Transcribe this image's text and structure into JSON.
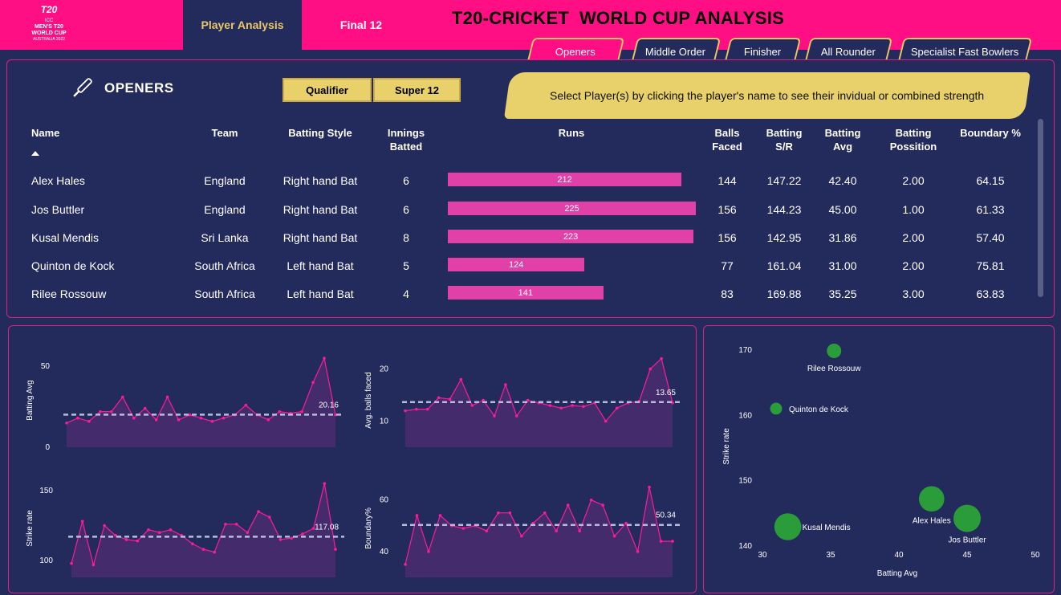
{
  "header": {
    "logo_lines": [
      "ICC",
      "MEN'S T20",
      "WORLD CUP",
      "AUSTRALIA 2022"
    ],
    "tabs": [
      {
        "label": "Player Analysis",
        "active": true
      },
      {
        "label": "Final 12",
        "active": false
      }
    ],
    "title": "T20-CRICKET  WORLD CUP ANALYSIS"
  },
  "categories": [
    {
      "label": "Openers",
      "active": true
    },
    {
      "label": "Middle Order",
      "active": false
    },
    {
      "label": "Finisher",
      "active": false
    },
    {
      "label": "All Rounder",
      "active": false
    },
    {
      "label": "Specialist Fast Bowlers",
      "active": false
    }
  ],
  "section": {
    "title": "OPENERS",
    "stage_buttons": [
      "Qualifier",
      "Super 12"
    ],
    "info": "Select Player(s) by clicking the player's name to see their invidual or combined strength"
  },
  "table": {
    "headers": {
      "name": "Name",
      "team": "Team",
      "style": "Batting Style",
      "innings": [
        "Innings",
        "Batted"
      ],
      "runs": "Runs",
      "balls": [
        "Balls",
        "Faced"
      ],
      "sr": [
        "Batting",
        "S/R"
      ],
      "avg": [
        "Batting",
        "Avg"
      ],
      "pos": [
        "Batting",
        "Possition"
      ],
      "boundary": "Boundary %"
    },
    "runs_max": 225,
    "rows": [
      {
        "name": "Alex Hales",
        "team": "England",
        "style": "Right hand Bat",
        "innings": "6",
        "runs": 212,
        "balls": "144",
        "sr": "147.22",
        "avg": "42.40",
        "pos": "2.00",
        "boundary": "64.15"
      },
      {
        "name": "Jos Buttler",
        "team": "England",
        "style": "Right hand Bat",
        "innings": "6",
        "runs": 225,
        "balls": "156",
        "sr": "144.23",
        "avg": "45.00",
        "pos": "1.00",
        "boundary": "61.33"
      },
      {
        "name": "Kusal Mendis",
        "team": "Sri Lanka",
        "style": "Right hand Bat",
        "innings": "8",
        "runs": 223,
        "balls": "156",
        "sr": "142.95",
        "avg": "31.86",
        "pos": "2.00",
        "boundary": "57.40"
      },
      {
        "name": "Quinton de Kock",
        "team": "South Africa",
        "style": "Left hand Bat",
        "innings": "5",
        "runs": 124,
        "balls": "77",
        "sr": "161.04",
        "avg": "31.00",
        "pos": "2.00",
        "boundary": "75.81"
      },
      {
        "name": "Rilee Rossouw",
        "team": "South Africa",
        "style": "Left hand Bat",
        "innings": "4",
        "runs": 141,
        "balls": "83",
        "sr": "169.88",
        "avg": "35.25",
        "pos": "3.00",
        "boundary": "63.83"
      }
    ]
  },
  "chart_data": [
    {
      "type": "area",
      "ylabel": "Batting Avg",
      "yticks": [
        0,
        50
      ],
      "ylim": [
        0,
        58
      ],
      "average": 20.16,
      "average_label": "20.16",
      "values": [
        15,
        18,
        16,
        22,
        22,
        31,
        18,
        24,
        17,
        31,
        17,
        20,
        18,
        16,
        18,
        20,
        26,
        20,
        17,
        22,
        21,
        22,
        40,
        55,
        20
      ]
    },
    {
      "type": "area",
      "ylabel": "Avg. balls faced",
      "yticks": [
        10,
        20
      ],
      "ylim": [
        5,
        23
      ],
      "average": 13.65,
      "average_label": "13.65",
      "values": [
        12,
        12.3,
        12.3,
        14.5,
        14.2,
        18,
        13,
        14,
        11,
        17,
        11,
        14,
        13.5,
        13,
        12.5,
        13,
        12.8,
        13.5,
        10,
        12.5,
        13.5,
        13.8,
        20,
        22,
        13.5
      ]
    },
    {
      "type": "area",
      "ylabel": "Strike rate",
      "yticks": [
        100,
        150
      ],
      "ylim": [
        88,
        158
      ],
      "average": 117.08,
      "average_label": "117.08",
      "values": [
        98,
        128,
        97,
        125,
        118,
        115,
        114,
        122,
        120,
        122,
        118,
        112,
        108,
        106,
        126,
        126,
        120,
        135,
        131,
        115,
        116,
        119,
        123,
        155,
        108
      ]
    },
    {
      "type": "area",
      "ylabel": "Boundary%",
      "yticks": [
        40,
        60
      ],
      "ylim": [
        30,
        68
      ],
      "average": 50.34,
      "average_label": "50.34",
      "values": [
        35,
        54,
        40,
        54,
        50,
        49,
        50,
        48,
        55,
        55,
        46,
        51,
        55,
        48,
        58,
        48,
        60,
        58,
        46,
        51,
        40,
        65,
        44,
        44
      ]
    },
    {
      "type": "scatter",
      "xlabel": "Batting Avg",
      "ylabel": "Strike rate",
      "xlim": [
        30,
        50
      ],
      "ylim": [
        140,
        170
      ],
      "xticks": [
        30,
        35,
        40,
        45,
        50
      ],
      "yticks": [
        140,
        150,
        160,
        170
      ],
      "points": [
        {
          "label": "Rilee Rossouw",
          "x": 35.25,
          "y": 169.88,
          "size": 141
        },
        {
          "label": "Quinton de Kock",
          "x": 31.0,
          "y": 161.04,
          "size": 124
        },
        {
          "label": "Alex Hales",
          "x": 42.4,
          "y": 147.22,
          "size": 212
        },
        {
          "label": "Jos Buttler",
          "x": 45.0,
          "y": 144.23,
          "size": 225
        },
        {
          "label": "Kusal Mendis",
          "x": 31.86,
          "y": 142.95,
          "size": 223
        }
      ]
    }
  ],
  "colors": {
    "background": "#232a5c",
    "accent_pink": "#ff0f83",
    "bar_pink": "#e040a8",
    "gold": "#e8d06a",
    "scatter_green": "#2a9d3a"
  }
}
